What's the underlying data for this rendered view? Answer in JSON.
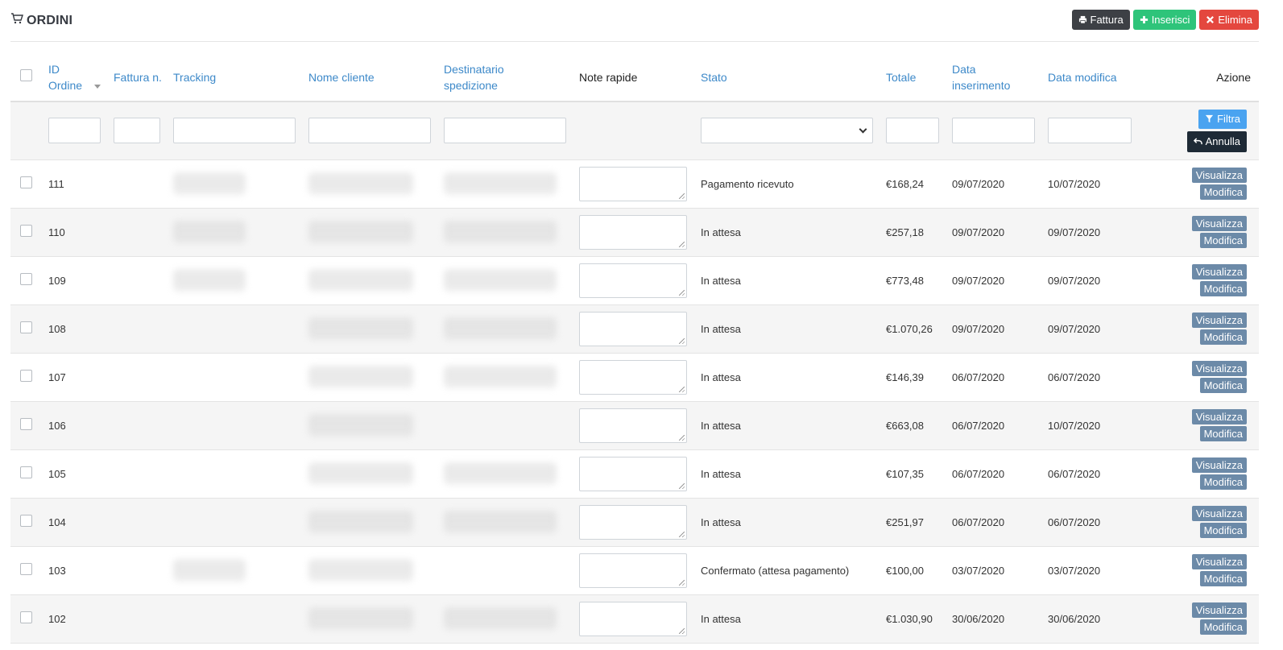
{
  "header": {
    "title": "ORDINI",
    "buttons": {
      "fattura": "Fattura",
      "inserisci": "Inserisci",
      "elimina": "Elimina"
    }
  },
  "columns": {
    "id": "ID Ordine",
    "fattura": "Fattura n.",
    "tracking": "Tracking",
    "cliente": "Nome cliente",
    "destinatario": "Destinatario spedizione",
    "note": "Note rapide",
    "stato": "Stato",
    "totale": "Totale",
    "data_ins": "Data inserimento",
    "data_mod": "Data modifica",
    "azione": "Azione"
  },
  "filters": {
    "filtra": "Filtra",
    "annulla": "Annulla"
  },
  "actions": {
    "visualizza": "Visualizza",
    "modifica": "Modifica"
  },
  "orders": [
    {
      "id": "111",
      "stato": "Pagamento ricevuto",
      "totale": "€168,24",
      "data_ins": "09/07/2020",
      "data_mod": "10/07/2020"
    },
    {
      "id": "110",
      "stato": "In attesa",
      "totale": "€257,18",
      "data_ins": "09/07/2020",
      "data_mod": "09/07/2020"
    },
    {
      "id": "109",
      "stato": "In attesa",
      "totale": "€773,48",
      "data_ins": "09/07/2020",
      "data_mod": "09/07/2020"
    },
    {
      "id": "108",
      "stato": "In attesa",
      "totale": "€1.070,26",
      "data_ins": "09/07/2020",
      "data_mod": "09/07/2020"
    },
    {
      "id": "107",
      "stato": "In attesa",
      "totale": "€146,39",
      "data_ins": "06/07/2020",
      "data_mod": "06/07/2020"
    },
    {
      "id": "106",
      "stato": "In attesa",
      "totale": "€663,08",
      "data_ins": "06/07/2020",
      "data_mod": "10/07/2020"
    },
    {
      "id": "105",
      "stato": "In attesa",
      "totale": "€107,35",
      "data_ins": "06/07/2020",
      "data_mod": "06/07/2020"
    },
    {
      "id": "104",
      "stato": "In attesa",
      "totale": "€251,97",
      "data_ins": "06/07/2020",
      "data_mod": "06/07/2020"
    },
    {
      "id": "103",
      "stato": "Confermato (attesa pagamento)",
      "totale": "€100,00",
      "data_ins": "03/07/2020",
      "data_mod": "03/07/2020"
    },
    {
      "id": "102",
      "stato": "In attesa",
      "totale": "€1.030,90",
      "data_ins": "30/06/2020",
      "data_mod": "30/06/2020"
    }
  ]
}
